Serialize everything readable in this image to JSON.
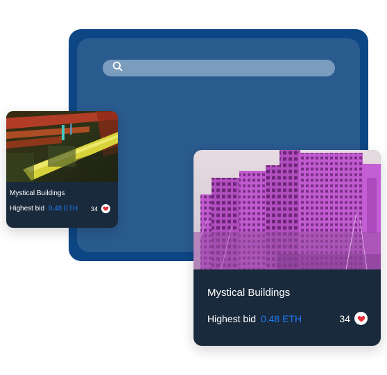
{
  "search": {
    "placeholder": "",
    "value": ""
  },
  "cards": [
    {
      "title": "Mystical Buildings",
      "bid_label": "Highest bid",
      "bid_value": "0.48 ETH",
      "likes": "34",
      "image_desc": "neon abstract"
    },
    {
      "title": "Mystical Buildings",
      "bid_label": "Highest bid",
      "bid_value": "0.48 ETH",
      "likes": "34",
      "image_desc": "purple apartment buildings"
    }
  ],
  "colors": {
    "frame": "#0d4684",
    "inner": "#2a5b8f",
    "search": "#7a9cbd",
    "card": "#1a2a3d",
    "accent": "#1f7bf2",
    "heart": "#e8303d"
  },
  "icons": {
    "search": "search-icon",
    "heart": "heart-icon"
  }
}
